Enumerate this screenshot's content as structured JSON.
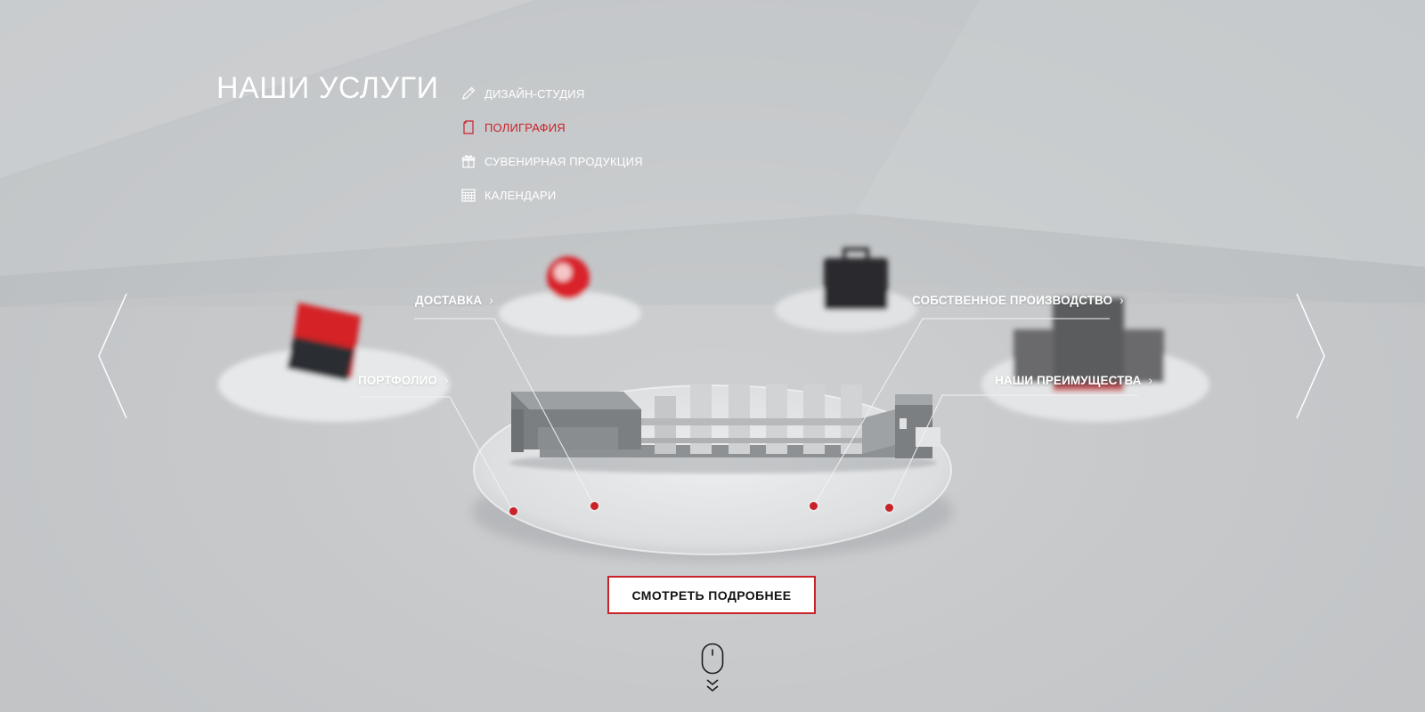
{
  "section": {
    "title": "НАШИ УСЛУГИ"
  },
  "services_menu": [
    {
      "label": "ДИЗАЙН-СТУДИЯ",
      "icon": "pencil-icon",
      "active": false
    },
    {
      "label": "ПОЛИГРАФИЯ",
      "icon": "document-icon",
      "active": true
    },
    {
      "label": "СУВЕНИРНАЯ ПРОДУКЦИЯ",
      "icon": "gift-icon",
      "active": false
    },
    {
      "label": "КАЛЕНДАРИ",
      "icon": "calendar-icon",
      "active": false
    }
  ],
  "hotspots": {
    "delivery": "ДОСТАВКА",
    "production": "СОБСТВЕННОЕ ПРОИЗВОДСТВО",
    "portfolio": "ПОРТФОЛИО",
    "advantages": "НАШИ ПРЕИМУЩЕСТВА",
    "chevron": "›"
  },
  "cta": {
    "label": "СМОТРЕТЬ ПОДРОБНЕЕ"
  },
  "colors": {
    "accent": "#c9232a",
    "text_light": "#ffffff",
    "background": "#c9cbcd"
  }
}
